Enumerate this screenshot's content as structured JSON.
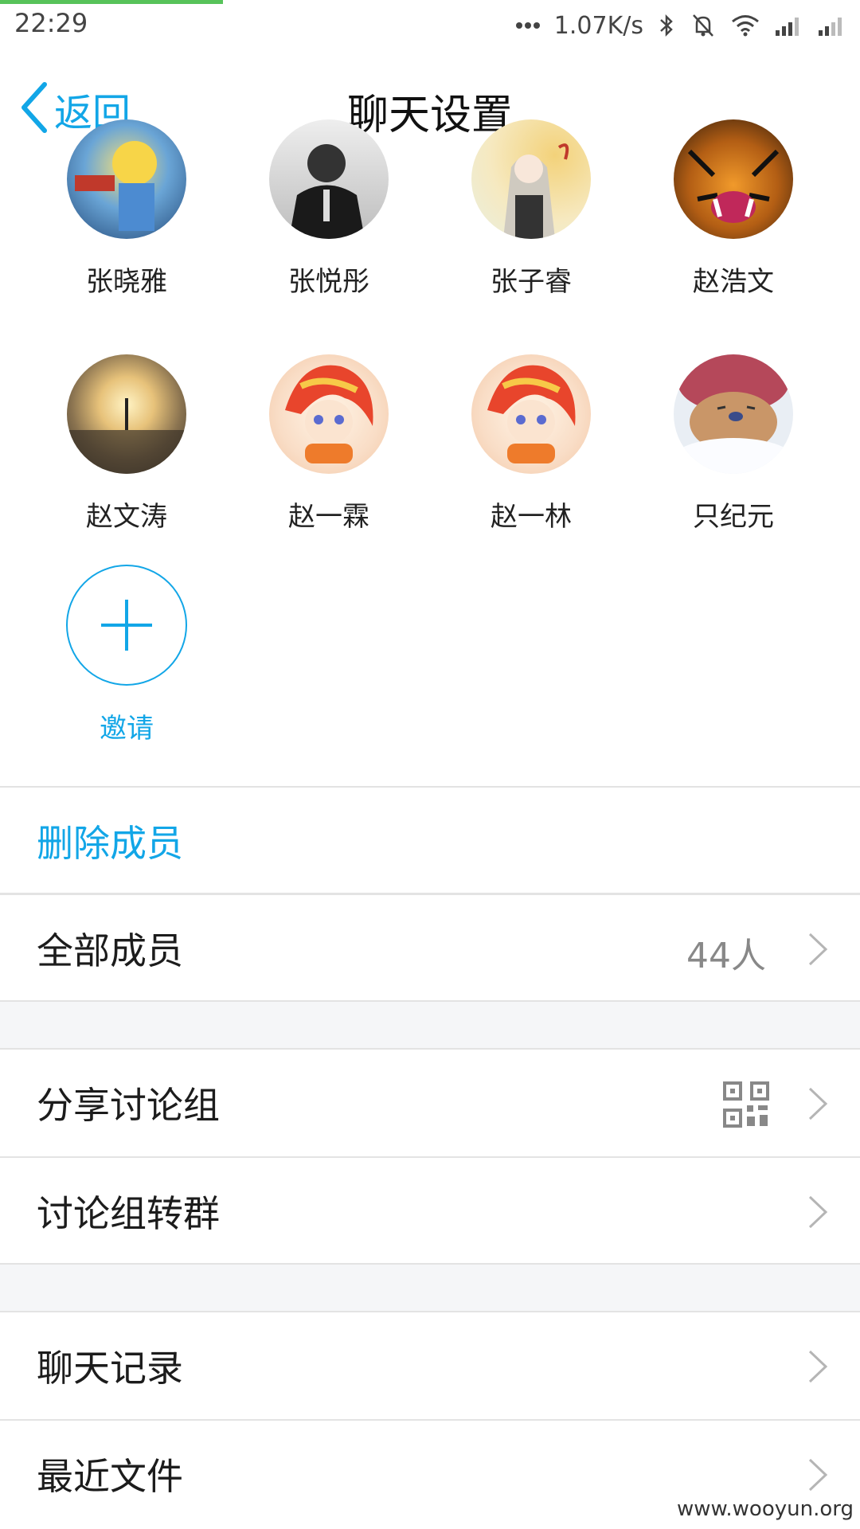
{
  "status_bar": {
    "time": "22:29",
    "network_speed": "1.07K/s",
    "icons": [
      "more-dots-icon",
      "bluetooth-icon",
      "mute-icon",
      "wifi-icon",
      "signal-icon",
      "signal-icon"
    ]
  },
  "header": {
    "back_label": "返回",
    "title": "聊天设置"
  },
  "members": [
    {
      "name": "张晓雅",
      "avatar": "anime-character-avatar"
    },
    {
      "name": "张悦彤",
      "avatar": "uniform-person-avatar"
    },
    {
      "name": "张子睿",
      "avatar": "anime-fox-girl-avatar"
    },
    {
      "name": "赵浩文",
      "avatar": "tiger-avatar"
    },
    {
      "name": "赵文涛",
      "avatar": "sunset-landscape-avatar"
    },
    {
      "name": "赵一霖",
      "avatar": "red-hair-girl-avatar"
    },
    {
      "name": "赵一林",
      "avatar": "red-hair-girl-avatar"
    },
    {
      "name": "只纪元",
      "avatar": "sleeping-bear-avatar"
    }
  ],
  "invite": {
    "label": "邀请"
  },
  "settings": {
    "remove_members": "删除成员",
    "all_members": {
      "label": "全部成员",
      "value": "44人"
    },
    "share_group": "分享讨论组",
    "convert_group": "讨论组转群",
    "chat_history": "聊天记录",
    "recent_files": "最近文件"
  },
  "colors": {
    "accent": "#12a6e7",
    "progress": "#57c35a",
    "section_gap": "#f5f6f8"
  },
  "watermark": "www.wooyun.org"
}
